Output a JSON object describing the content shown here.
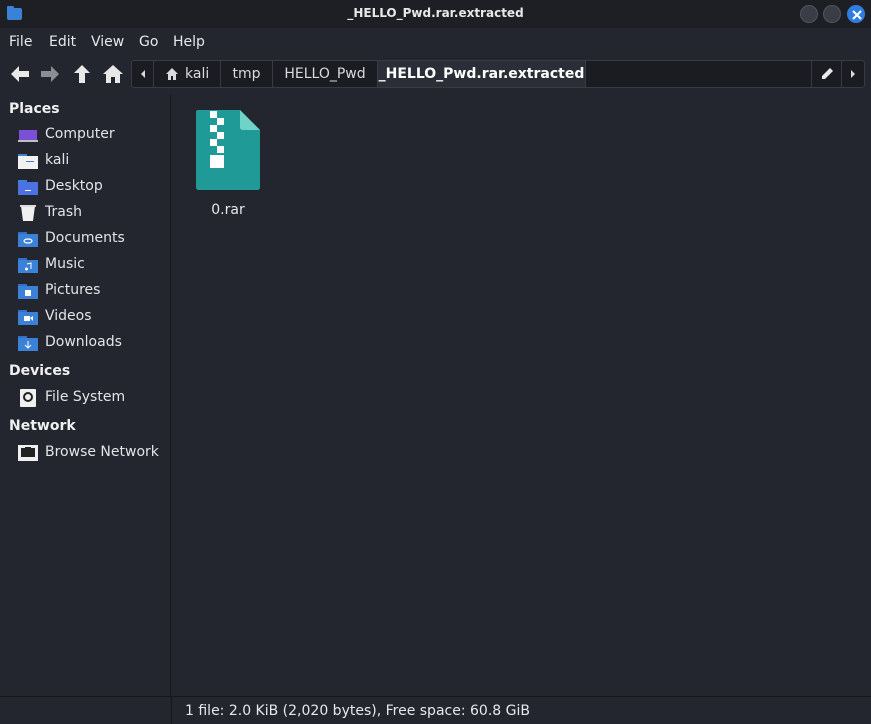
{
  "window": {
    "title": "_HELLO_Pwd.rar.extracted"
  },
  "menu": [
    "File",
    "Edit",
    "View",
    "Go",
    "Help"
  ],
  "path": [
    "kali",
    "tmp",
    "HELLO_Pwd",
    "_HELLO_Pwd.rar.extracted"
  ],
  "sidebar": {
    "places_header": "Places",
    "places": [
      {
        "label": "Computer",
        "icon": "computer-icon"
      },
      {
        "label": "kali",
        "icon": "home-folder-icon"
      },
      {
        "label": "Desktop",
        "icon": "desktop-icon"
      },
      {
        "label": "Trash",
        "icon": "trash-icon"
      },
      {
        "label": "Documents",
        "icon": "documents-folder-icon"
      },
      {
        "label": "Music",
        "icon": "music-folder-icon"
      },
      {
        "label": "Pictures",
        "icon": "pictures-folder-icon"
      },
      {
        "label": "Videos",
        "icon": "videos-folder-icon"
      },
      {
        "label": "Downloads",
        "icon": "downloads-folder-icon"
      }
    ],
    "devices_header": "Devices",
    "devices": [
      {
        "label": "File System",
        "icon": "drive-icon"
      }
    ],
    "network_header": "Network",
    "network": [
      {
        "label": "Browse Network",
        "icon": "network-icon"
      }
    ]
  },
  "files": [
    {
      "name": "0.rar",
      "icon": "archive-file-icon"
    }
  ],
  "status": {
    "text": "1 file: 2.0 KiB (2,020 bytes), Free space: 60.8 GiB"
  },
  "colors": {
    "accent": "#3b82d6",
    "archive": "#1f9a96",
    "background": "#23262e"
  }
}
